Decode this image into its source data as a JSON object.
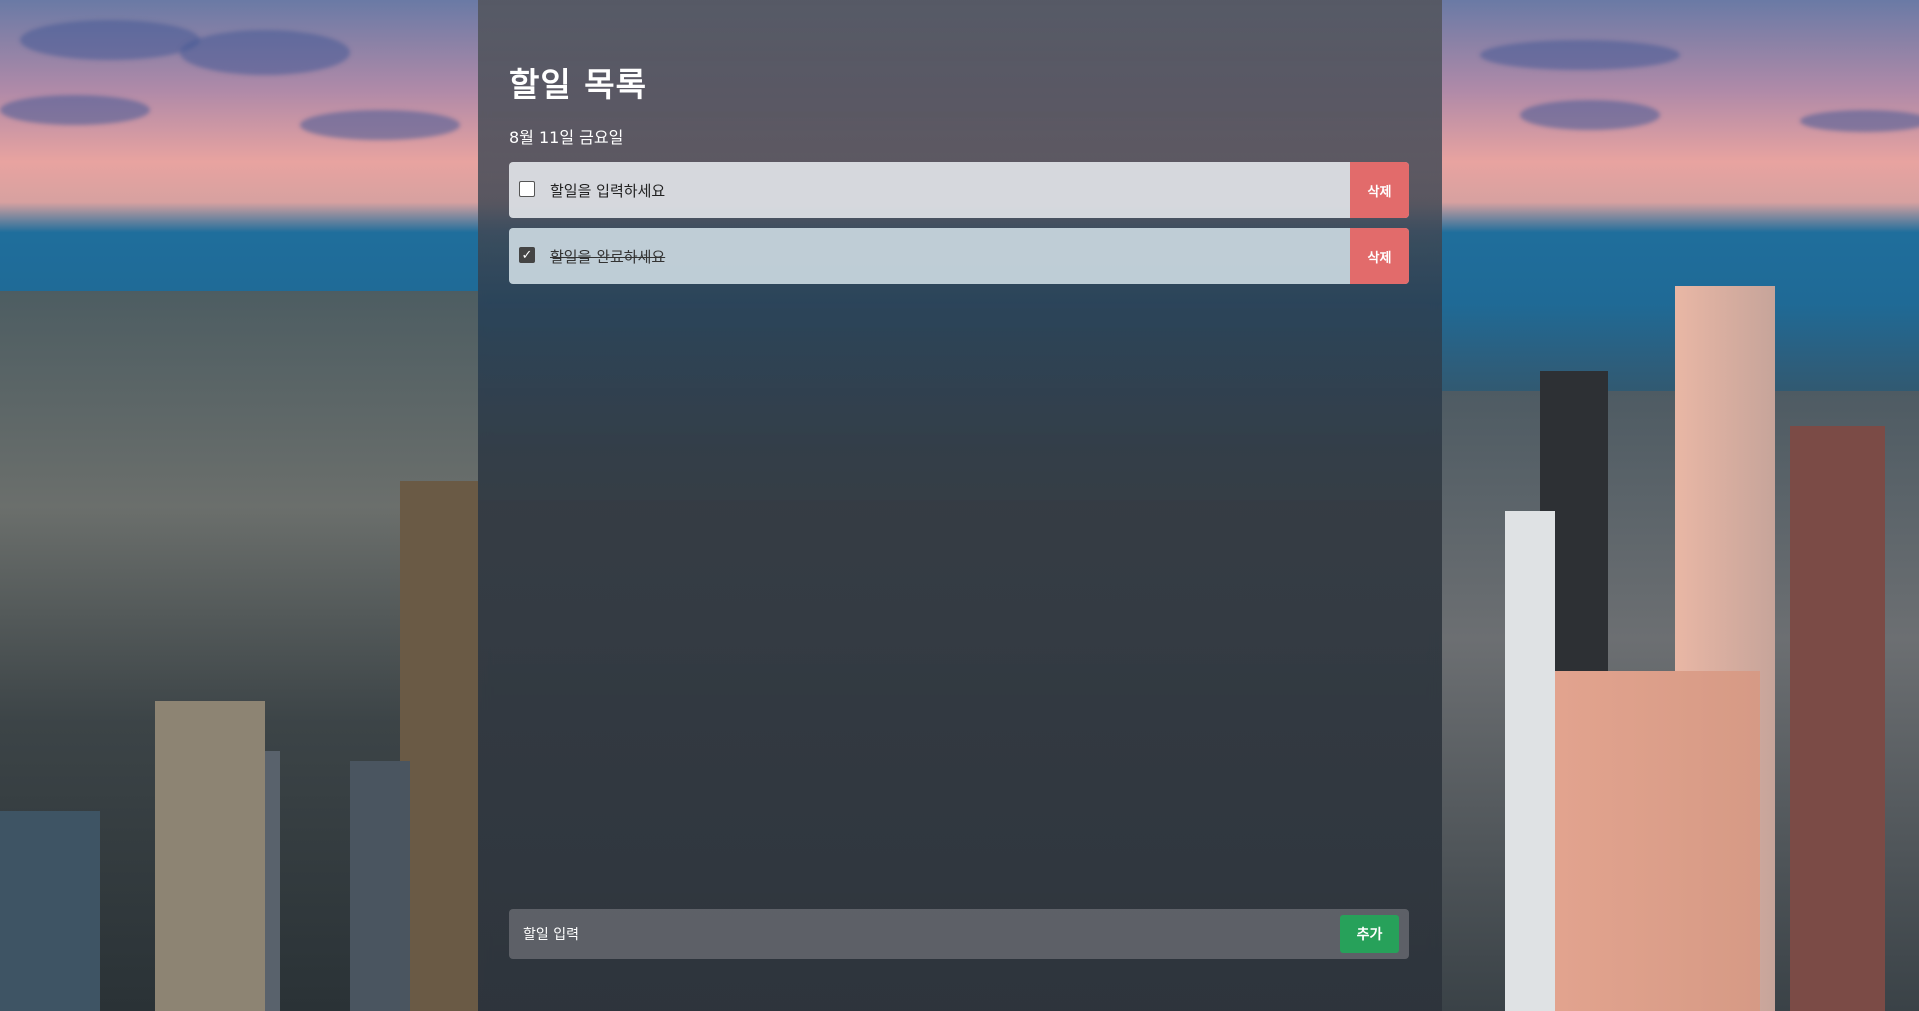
{
  "app": {
    "title": "할일 목록",
    "date": "8월 11일 금요일"
  },
  "todos": [
    {
      "text": "할일을 입력하세요",
      "done": false,
      "delete_label": "삭제"
    },
    {
      "text": "할일을 완료하세요",
      "done": true,
      "delete_label": "삭제"
    }
  ],
  "input": {
    "placeholder": "할일 입력",
    "add_label": "추가"
  },
  "colors": {
    "delete_button": "#e26b6b",
    "add_button": "#27a15a"
  }
}
